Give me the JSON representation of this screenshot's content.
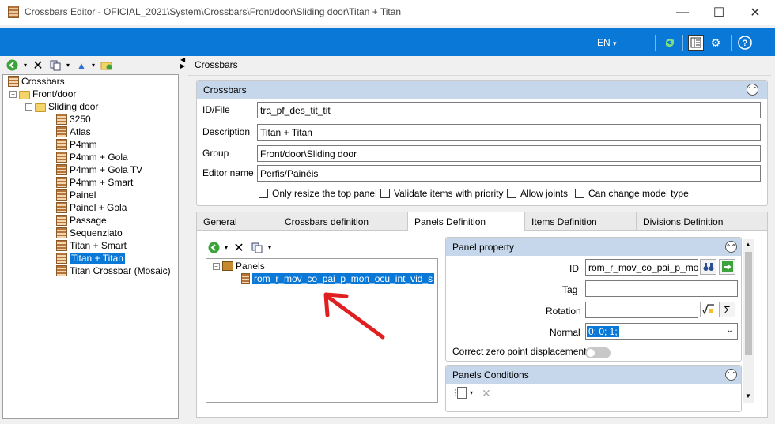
{
  "window": {
    "title": "Crossbars Editor - OFICIAL_2021\\System\\Crossbars\\Front/door\\Sliding door\\Titan + Titan"
  },
  "topbar": {
    "language": "EN",
    "language_arrow": "▾"
  },
  "tree": {
    "root": "Crossbars",
    "folder1": "Front/door",
    "folder2": "Sliding door",
    "items": [
      "3250",
      "Atlas",
      "P4mm",
      "P4mm + Gola",
      "P4mm + Gola TV",
      "P4mm + Smart",
      "Painel",
      "Painel + Gola",
      "Passage",
      "Sequenziato",
      "Titan + Smart",
      "Titan + Titan",
      "Titan Crossbar (Mosaic)"
    ],
    "selected": "Titan + Titan"
  },
  "main": {
    "header": "Crossbars"
  },
  "crossbars_panel": {
    "title": "Crossbars",
    "id_label": "ID/File",
    "id_value": "tra_pf_des_tit_tit",
    "desc_label": "Description",
    "desc_value": "Titan + Titan",
    "group_label": "Group",
    "group_value": "Front/door\\Sliding door",
    "editor_label": "Editor name",
    "editor_value": "Perfis/Painéis",
    "checks": [
      "Only resize the top panel",
      "Validate items with priority",
      "Allow joints",
      "Can change model type"
    ]
  },
  "tabs": [
    "General",
    "Crossbars definition",
    "Panels Definition",
    "Items Definition",
    "Divisions Definition"
  ],
  "active_tab": "Panels Definition",
  "panels_tree": {
    "root": "Panels",
    "item": "rom_r_mov_co_pai_p_mon_ocu_int_vid_s"
  },
  "panel_property": {
    "title": "Panel property",
    "id_label": "ID",
    "id_value": "rom_r_mov_co_pai_p_mon_ocu_int_vid_s",
    "tag_label": "Tag",
    "tag_value": "",
    "rotation_label": "Rotation",
    "rotation_value": "",
    "normal_label": "Normal",
    "normal_value": "0; 0; 1;",
    "zero_label": "Correct zero point displacement",
    "sigma": "Σ"
  },
  "conditions": {
    "title": "Panels Conditions"
  },
  "colors": {
    "accent": "#0a78d7",
    "panel_header": "#c7d7eb",
    "arrow": "#e02020"
  }
}
